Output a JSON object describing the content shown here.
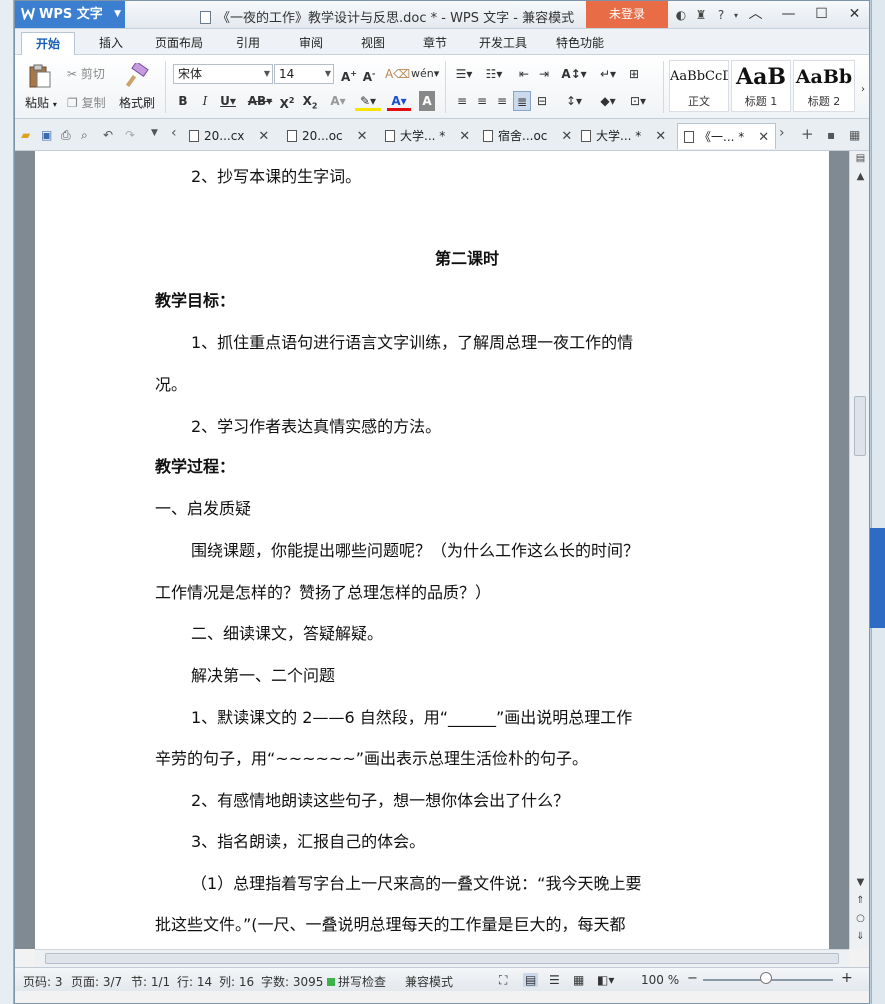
{
  "app": {
    "name": "WPS 文字",
    "title": "《一夜的工作》教学设计与反思.doc * - WPS 文字 - 兼容模式",
    "login": "未登录"
  },
  "menu_tabs": [
    "开始",
    "插入",
    "页面布局",
    "引用",
    "审阅",
    "视图",
    "章节",
    "开发工具",
    "特色功能"
  ],
  "ribbon": {
    "paste": "粘贴",
    "cut": "剪切",
    "copy": "复制",
    "format_painter": "格式刷",
    "font_name": "宋体",
    "font_size": "14",
    "styles": [
      {
        "sample": "AaBbCcD",
        "name": "正文"
      },
      {
        "sample": "AaB",
        "name": "标题 1"
      },
      {
        "sample": "AaBb",
        "name": "标题 2"
      }
    ]
  },
  "doc_tabs": [
    {
      "label": "20...cx"
    },
    {
      "label": "20...oc"
    },
    {
      "label": "大学... *"
    },
    {
      "label": "宿舍...oc"
    },
    {
      "label": "大学... *"
    },
    {
      "label": "《一... *"
    }
  ],
  "document": {
    "paragraphs": [
      "2、抄写本课的生字词。",
      "第二课时",
      "教学目标：",
      "1、抓住重点语句进行语言文字训练，了解周总理一夜工作的情",
      "况。",
      "2、学习作者表达真情实感的方法。",
      "教学过程：",
      "一、启发质疑",
      "围绕课题，你能提出哪些问题呢？（为什么工作这么长的时间？",
      "工作情况是怎样的？赞扬了总理怎样的品质？）",
      "二、细读课文，答疑解疑。",
      "解决第一、二个问题",
      "1、默读课文的 2——6 自然段，用“______”画出说明总理工作",
      "辛劳的句子，用“~~~~~~”画出表示总理生活俭朴的句子。",
      "2、有感情地朗读这些句子，想一想你体会出了什么？",
      "3、指名朗读，汇报自己的体会。",
      "（1）总理指着写字台上一尺来高的一叠文件说：“我今天晚上要",
      "批这些文件。”(一尺、一叠说明总理每天的工作量是巨大的，每天都"
    ]
  },
  "status": {
    "page_num": "页码: 3",
    "page": "页面: 3/7",
    "section": "节: 1/1",
    "row": "行: 14",
    "col": "列: 16",
    "wordcount": "字数: 3095",
    "spellcheck": "拼写检查",
    "compat": "兼容模式",
    "zoom": "100 %"
  }
}
